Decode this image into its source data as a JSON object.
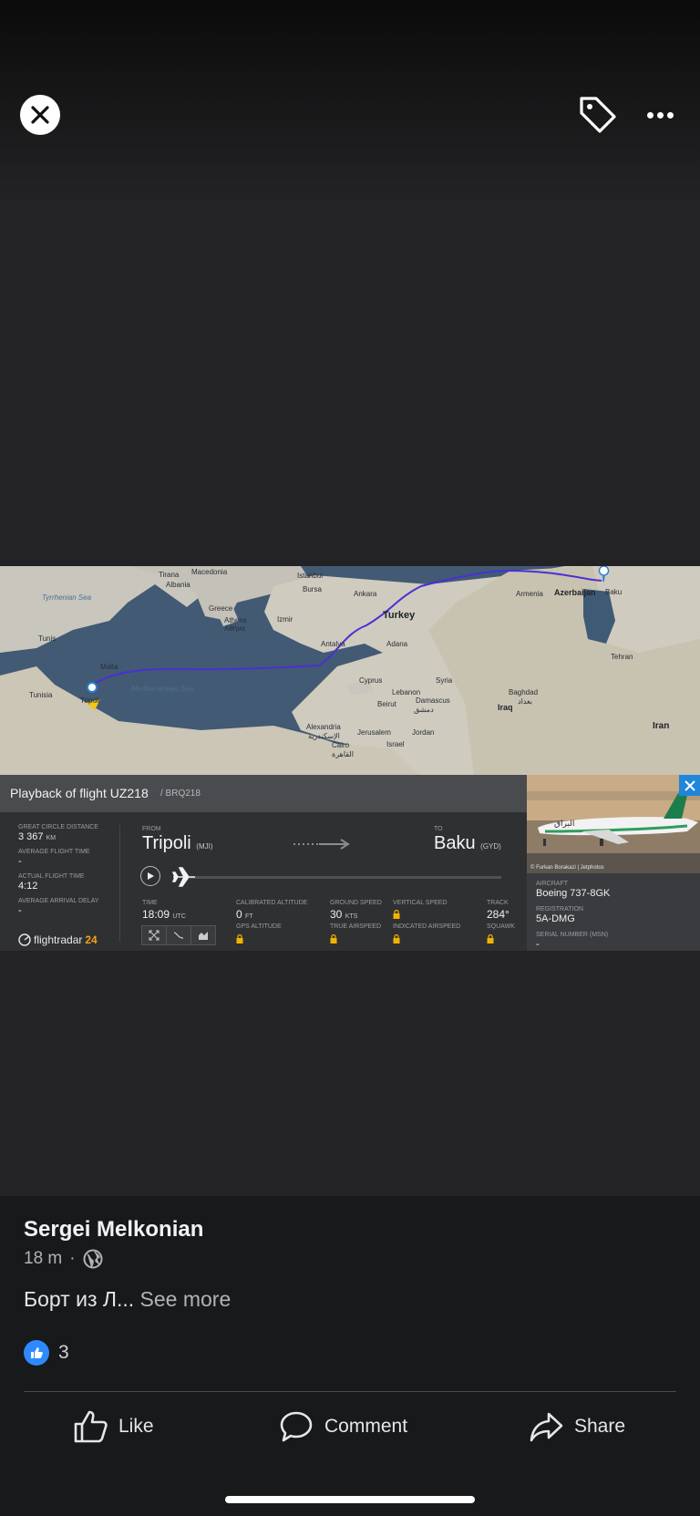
{
  "viewer": {
    "close_icon": "close-icon",
    "tag_icon": "tag-icon",
    "more_icon": "more-horizontal-icon"
  },
  "map": {
    "labels": {
      "tirana": "Tirana",
      "albania": "Albania",
      "macedonia": "Macedonia",
      "istanbul": "Istanbul",
      "bursa": "Bursa",
      "ankara": "Ankara",
      "armenia": "Armenia",
      "azerbaijan": "Azerbaijan",
      "baku": "Baku",
      "tyrrhenian": "Tyrrhenian Sea",
      "greece": "Greece",
      "athens": "Athens",
      "athens_gr": "Αθήνα",
      "izmir": "Izmir",
      "turkey": "Turkey",
      "tunis": "Tunis",
      "malta": "Malta",
      "antalya": "Antalya",
      "adana": "Adana",
      "tehran": "Tehran",
      "tunisia": "Tunisia",
      "tripoli": "Tripoli",
      "med_sea": "Mediterranean Sea",
      "cyprus": "Cyprus",
      "syria": "Syria",
      "lebanon": "Lebanon",
      "beirut": "Beirut",
      "damascus": "Damascus",
      "damascus_ar": "دمشق",
      "baghdad": "Baghdad",
      "baghdad_ar": "بغداد",
      "iraq": "Iraq",
      "iran": "Iran",
      "alexandria": "Alexandria",
      "alexandria_ar": "الإسكندرية",
      "jerusalem": "Jerusalem",
      "jordan": "Jordan",
      "cairo": "Cairo",
      "cairo_ar": "القاهرة",
      "israel": "Israel"
    }
  },
  "playback": {
    "title": "Playback of flight UZ218",
    "subtitle": "/ BRQ218",
    "great_circle_label": "GREAT CIRCLE DISTANCE",
    "great_circle_value": "3 367",
    "great_circle_unit": "KM",
    "avg_flight_time_label": "AVERAGE FLIGHT TIME",
    "avg_flight_time_value": "-",
    "actual_flight_time_label": "ACTUAL FLIGHT TIME",
    "actual_flight_time_value": "4:12",
    "avg_arrival_delay_label": "AVERAGE ARRIVAL DELAY",
    "avg_arrival_delay_value": "-",
    "from_label": "FROM",
    "from_city": "Tripoli",
    "from_code": "(MJI)",
    "to_label": "TO",
    "to_city": "Baku",
    "to_code": "(GYD)",
    "time_label": "TIME",
    "time_value": "18:09",
    "time_unit": "UTC",
    "cal_alt_label": "CALIBRATED ALTITUDE",
    "cal_alt_value": "0",
    "cal_alt_unit": "FT",
    "gps_alt_label": "GPS ALTITUDE",
    "ground_speed_label": "GROUND SPEED",
    "ground_speed_value": "30",
    "ground_speed_unit": "KTS",
    "true_airspeed_label": "TRUE AIRSPEED",
    "vertical_speed_label": "VERTICAL SPEED",
    "indicated_airspeed_label": "INDICATED AIRSPEED",
    "track_label": "TRACK",
    "track_value": "284°",
    "squawk_label": "SQUAWK",
    "brand_main": "flightradar",
    "brand_num": "24"
  },
  "aircraft": {
    "photo_credit": "© Furkan Borakazi | Jetphotos",
    "livery_text": "البراق",
    "aircraft_label": "AIRCRAFT",
    "aircraft_value": "Boeing 737-8GK",
    "registration_label": "REGISTRATION",
    "registration_value": "5A-DMG",
    "serial_label": "SERIAL NUMBER (MSN)",
    "serial_value": "-"
  },
  "post": {
    "author": "Sergei Melkonian",
    "time": "18 m",
    "dot": "·",
    "text": "Борт из Л...",
    "see_more": "See more",
    "reaction_count": "3",
    "like_label": "Like",
    "comment_label": "Comment",
    "share_label": "Share"
  }
}
